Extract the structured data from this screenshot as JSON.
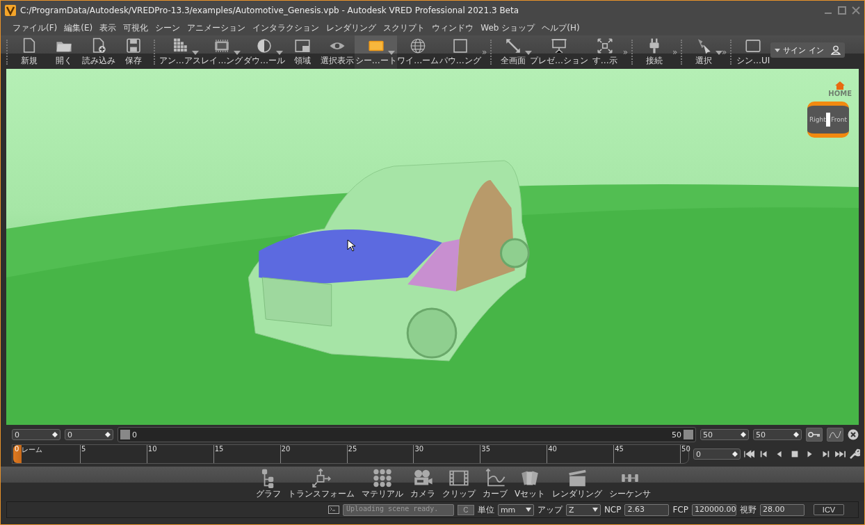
{
  "window": {
    "title": "C:/ProgramData/Autodesk/VREDPro-13.3/examples/Automotive_Genesis.vpb - Autodesk VRED Professional 2021.3 Beta"
  },
  "menu": [
    "ファイル(F)",
    "編集(E)",
    "表示",
    "可視化",
    "シーン",
    "アニメーション",
    "インタラクション",
    "レンダリング",
    "スクリプト",
    "ウィンドウ",
    "Web ショップ",
    "ヘルプ(H)"
  ],
  "toolbar": {
    "groups": [
      {
        "items": [
          {
            "label": "新規",
            "dropdown": false,
            "selected": false
          },
          {
            "label": "開く",
            "dropdown": false,
            "selected": false
          },
          {
            "label": "読み込み",
            "dropdown": false,
            "selected": false
          },
          {
            "label": "保存",
            "dropdown": false,
            "selected": false
          }
        ]
      },
      {
        "overflow": "»",
        "items": [
          {
            "label": "アン…アス",
            "dropdown": true,
            "selected": false
          },
          {
            "label": "レイ…ング",
            "dropdown": true,
            "selected": false
          },
          {
            "label": "ダウ…ール",
            "dropdown": true,
            "selected": false
          },
          {
            "label": "領域",
            "dropdown": false,
            "selected": false
          },
          {
            "label": "選択表示",
            "dropdown": false,
            "selected": false
          },
          {
            "label": "シー…ート",
            "dropdown": true,
            "selected": true
          },
          {
            "label": "ワイ…ーム",
            "dropdown": false,
            "selected": false
          },
          {
            "label": "パウ…ング",
            "dropdown": false,
            "selected": false
          }
        ]
      },
      {
        "overflow": "»",
        "items": [
          {
            "label": "全画面",
            "dropdown": true,
            "selected": false
          },
          {
            "label": "プレゼ…ション",
            "dropdown": false,
            "selected": false
          },
          {
            "label": "す…示",
            "dropdown": false,
            "selected": false
          }
        ]
      },
      {
        "overflow": "»",
        "items": [
          {
            "label": "接続",
            "dropdown": false,
            "selected": false
          }
        ]
      },
      {
        "overflow": "»",
        "items": [
          {
            "label": "選択",
            "dropdown": true,
            "selected": false
          }
        ]
      },
      {
        "items": [
          {
            "label": "シン…UI",
            "dropdown": false,
            "selected": false
          }
        ]
      }
    ],
    "sign_in": "サイン イン"
  },
  "nav_cube": {
    "home": "HOME",
    "right": "Right",
    "front": "Front"
  },
  "timeline": {
    "left_fields": [
      "0",
      "0"
    ],
    "slider_start": "0",
    "slider_end": "50",
    "right_fields": [
      "50",
      "50"
    ],
    "ruler": {
      "marker": "0",
      "caption": "レーム",
      "ticks": [
        "5",
        "10",
        "15",
        "20",
        "25",
        "30",
        "35",
        "40",
        "45",
        "50"
      ]
    },
    "current_frame": "0"
  },
  "modules": [
    "グラフ",
    "トランスフォーム",
    "マテリアル",
    "カメラ",
    "クリップ",
    "カーブ",
    "Vセット",
    "レンダリング",
    "シーケンサ"
  ],
  "status": {
    "console": "Uploading scene ready.",
    "clear_button": "C",
    "unit_label": "単位",
    "unit": "mm",
    "up_label": "アップ",
    "up": "Z",
    "ncp_label": "NCP",
    "ncp": "2.63",
    "fcp_label": "FCP",
    "fcp": "120000.00",
    "fov_label": "視野",
    "fov": "28.00",
    "icv_button": "ICV"
  }
}
